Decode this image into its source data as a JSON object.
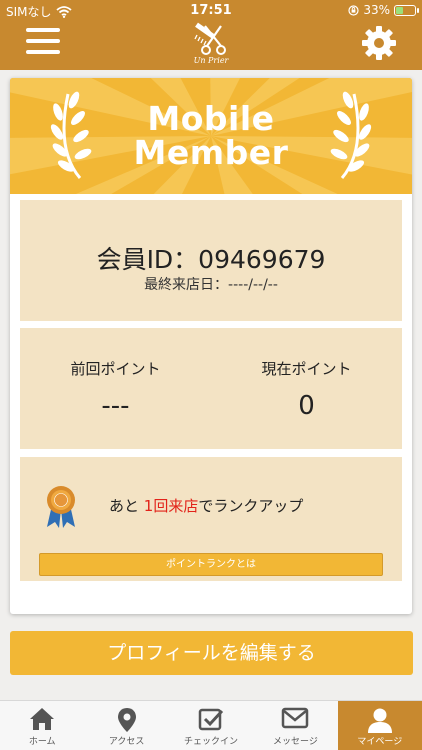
{
  "status_bar": {
    "carrier": "SIMなし",
    "time": "17:51",
    "battery": "33%"
  },
  "header": {
    "logo_text": "Un Prier"
  },
  "banner": {
    "title_line1": "Mobile",
    "title_line2": "Member"
  },
  "member": {
    "id_text": "会員ID：09469679",
    "last_visit_text": "最終来店日：----/--/--"
  },
  "points": {
    "previous_label": "前回ポイント",
    "previous_value": "---",
    "current_label": "現在ポイント",
    "current_value": "0"
  },
  "rank": {
    "prefix": "あと ",
    "highlight": "1回来店",
    "suffix": "でランクアップ",
    "button_label": "ポイントランクとは"
  },
  "edit_profile_label": "プロフィールを編集する",
  "tabs": [
    {
      "label": "ホーム",
      "icon": "home-icon",
      "active": false
    },
    {
      "label": "アクセス",
      "icon": "map-pin-icon",
      "active": false
    },
    {
      "label": "チェックイン",
      "icon": "checkin-icon",
      "active": false
    },
    {
      "label": "メッセージ",
      "icon": "mail-icon",
      "active": false
    },
    {
      "label": "マイページ",
      "icon": "user-icon",
      "active": true
    }
  ],
  "colors": {
    "header": "#c8892f",
    "accent": "#f2b735",
    "panel": "#f3e3c4",
    "highlight": "#e2231a"
  }
}
